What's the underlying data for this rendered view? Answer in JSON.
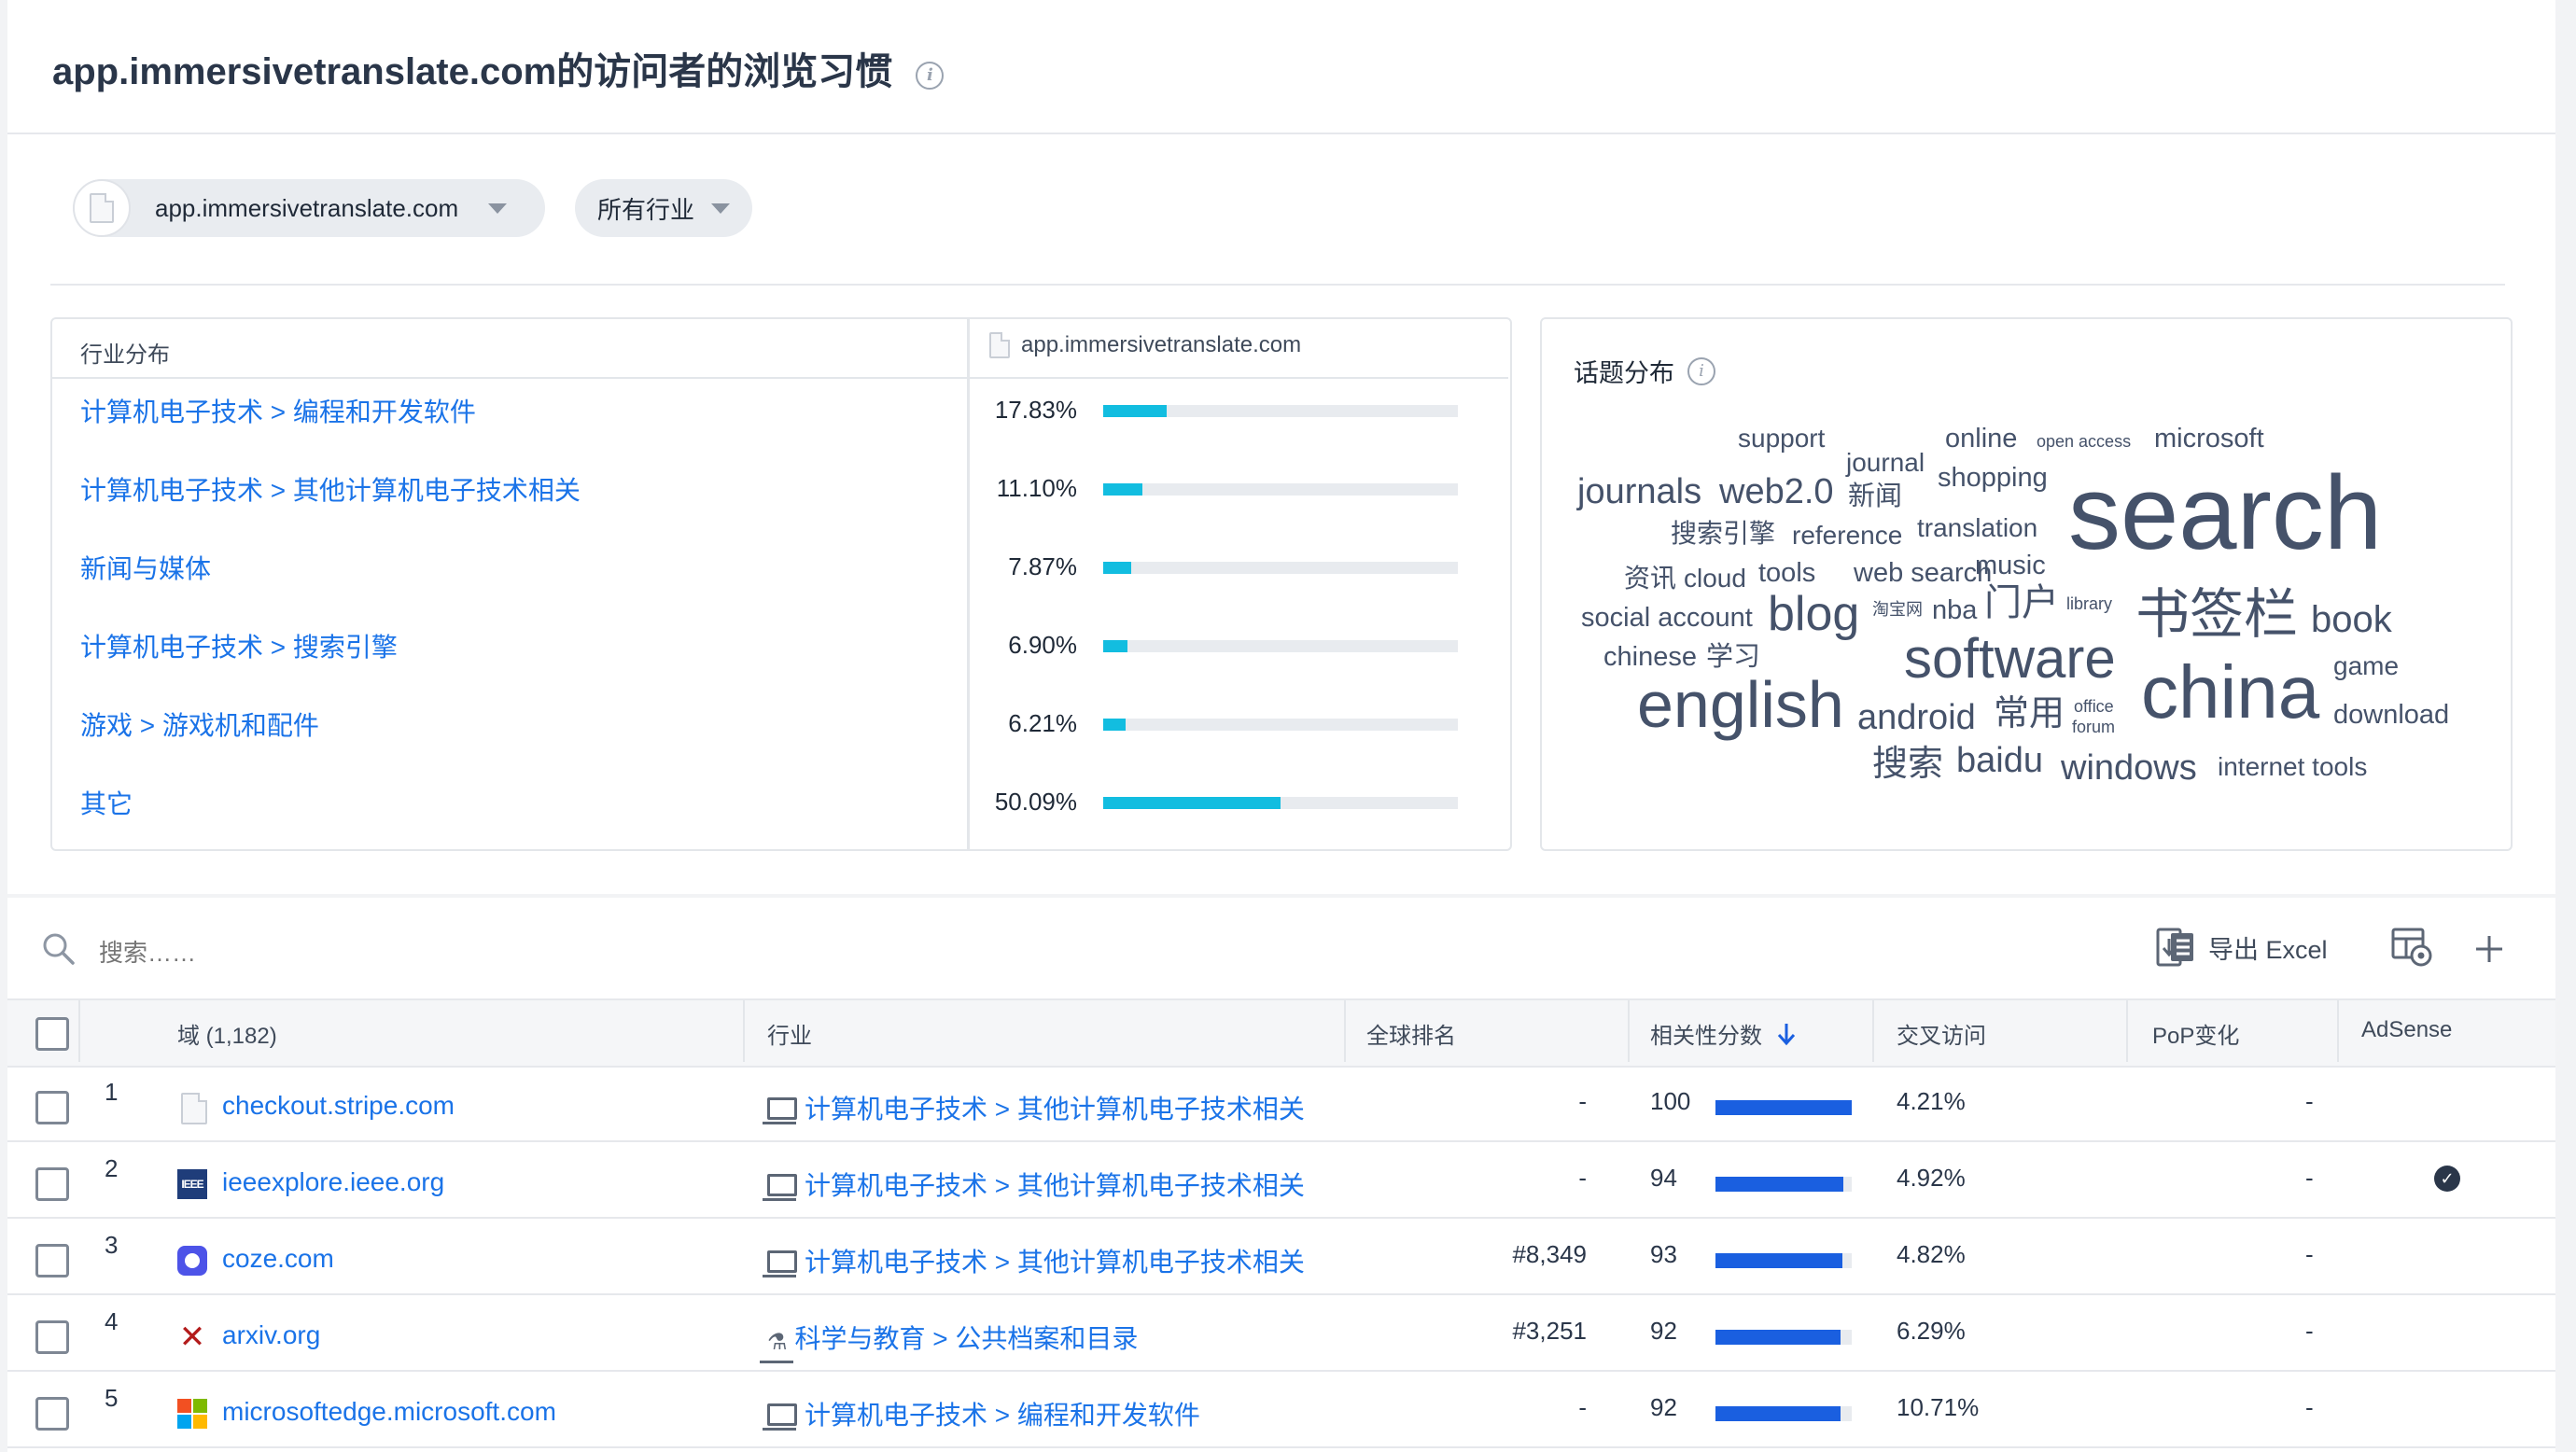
{
  "header": {
    "title": "app.immersivetranslate.com的访问者的浏览习惯"
  },
  "filters": {
    "site": "app.immersivetranslate.com",
    "industry": "所有行业"
  },
  "industry_panel": {
    "header": "行业分布",
    "site_header": "app.immersivetranslate.com",
    "rows": [
      {
        "label": "计算机电子技术 > 编程和开发软件",
        "pct_text": "17.83%",
        "pct": 17.83
      },
      {
        "label": "计算机电子技术 > 其他计算机电子技术相关",
        "pct_text": "11.10%",
        "pct": 11.1
      },
      {
        "label": "新闻与媒体",
        "pct_text": "7.87%",
        "pct": 7.87
      },
      {
        "label": "计算机电子技术 > 搜索引擎",
        "pct_text": "6.90%",
        "pct": 6.9
      },
      {
        "label": "游戏 > 游戏机和配件",
        "pct_text": "6.21%",
        "pct": 6.21
      },
      {
        "label": "其它",
        "pct_text": "50.09%",
        "pct": 50.09
      }
    ]
  },
  "topics": {
    "title": "话题分布",
    "words": [
      "support",
      "journal",
      "online",
      "open access",
      "microsoft",
      "journals",
      "web2.0",
      "新闻",
      "shopping",
      "search",
      "搜索引擎",
      "reference",
      "translation",
      "资讯",
      "cloud",
      "tools",
      "web search",
      "music",
      "淘宝网",
      "nba",
      "门户",
      "library",
      "书签栏",
      "book",
      "social account",
      "blog",
      "chinese",
      "学习",
      "software",
      "game",
      "english",
      "android",
      "常用",
      "office",
      "forum",
      "china",
      "download",
      "搜索",
      "baidu",
      "windows",
      "internet tools"
    ]
  },
  "toolbar": {
    "search_placeholder": "搜索……",
    "export_label": "导出 Excel"
  },
  "table": {
    "columns": {
      "domain": "域 (1,182)",
      "industry": "行业",
      "global_rank": "全球排名",
      "relevance": "相关性分数",
      "cross_visit": "交叉访问",
      "pop": "PoP变化",
      "adsense": "AdSense"
    },
    "rows": [
      {
        "index": "1",
        "domain": "checkout.stripe.com",
        "industry": "计算机电子技术 > 其他计算机电子技术相关",
        "rank": "-",
        "score": "100",
        "score_value": 100,
        "cross": "4.21%",
        "pop": "-",
        "adsense": false
      },
      {
        "index": "2",
        "domain": "ieeexplore.ieee.org",
        "industry": "计算机电子技术 > 其他计算机电子技术相关",
        "rank": "-",
        "score": "94",
        "score_value": 94,
        "cross": "4.92%",
        "pop": "-",
        "adsense": true
      },
      {
        "index": "3",
        "domain": "coze.com",
        "industry": "计算机电子技术 > 其他计算机电子技术相关",
        "rank": "#8,349",
        "score": "93",
        "score_value": 93,
        "cross": "4.82%",
        "pop": "-",
        "adsense": false
      },
      {
        "index": "4",
        "domain": "arxiv.org",
        "industry": "科学与教育 > 公共档案和目录",
        "rank": "#3,251",
        "score": "92",
        "score_value": 92,
        "cross": "6.29%",
        "pop": "-",
        "adsense": false
      },
      {
        "index": "5",
        "domain": "microsoftedge.microsoft.com",
        "industry": "计算机电子技术 > 编程和开发软件",
        "rank": "-",
        "score": "92",
        "score_value": 92,
        "cross": "10.71%",
        "pop": "-",
        "adsense": false
      }
    ]
  },
  "colors": {
    "link": "#1a73e8",
    "industry_bar": "#12bde0",
    "relevance_bar": "#1a5fe0"
  }
}
